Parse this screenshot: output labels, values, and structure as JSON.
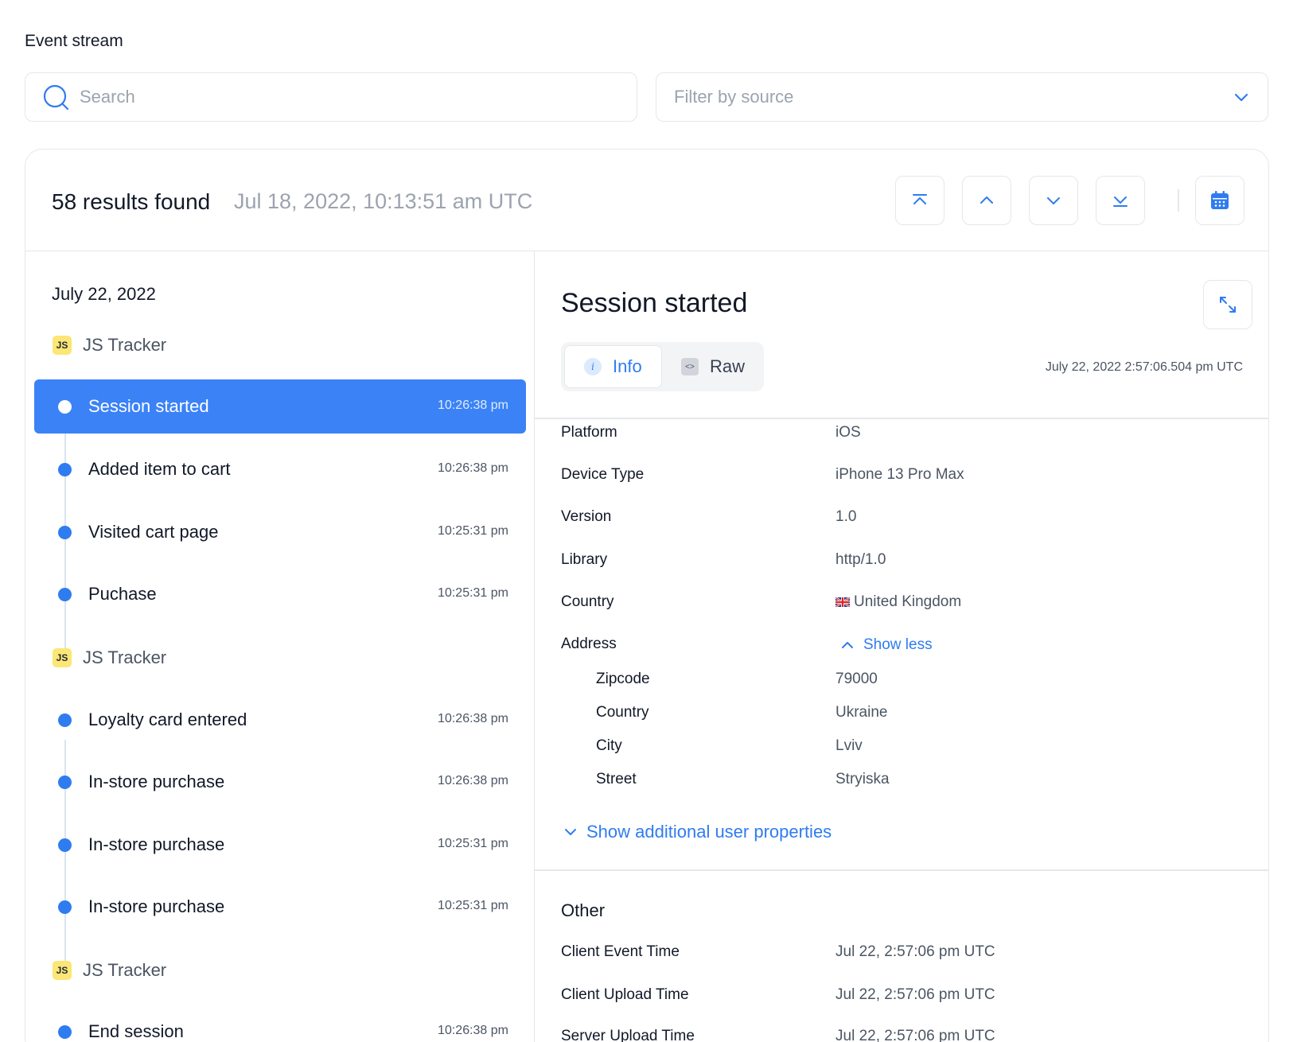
{
  "page": {
    "title": "Event stream"
  },
  "search": {
    "placeholder": "Search"
  },
  "filter": {
    "placeholder": "Filter by source"
  },
  "results": {
    "count_text": "58 results found",
    "date": "Jul 18, 2022, 10:13:51 am UTC"
  },
  "colors": {
    "accent": "#3b82f6",
    "link": "#2f7cf0",
    "badge": "#fce675",
    "border": "#e5e7eb"
  },
  "icons": [
    "search-icon",
    "chevron-down-icon",
    "jump-to-first-icon",
    "chevron-up-icon",
    "jump-to-last-icon",
    "calendar-icon",
    "expand-icon",
    "info-icon",
    "code-file-icon",
    "uk-flag-icon"
  ],
  "stream": {
    "date": "July 22, 2022",
    "groups": [
      {
        "source": "JS Tracker",
        "badge": "JS",
        "events": [
          {
            "name": "Session started",
            "time": "10:26:38 pm",
            "active": true
          },
          {
            "name": "Added item to cart",
            "time": "10:26:38 pm"
          },
          {
            "name": "Visited cart page",
            "time": "10:25:31 pm"
          },
          {
            "name": "Puchase",
            "time": "10:25:31 pm"
          }
        ]
      },
      {
        "source": "JS Tracker",
        "badge": "JS",
        "events": [
          {
            "name": "Loyalty card entered",
            "time": "10:26:38 pm"
          },
          {
            "name": "In-store purchase",
            "time": "10:26:38 pm"
          },
          {
            "name": "In-store purchase",
            "time": "10:25:31 pm"
          },
          {
            "name": "In-store purchase",
            "time": "10:25:31 pm"
          }
        ]
      },
      {
        "source": "JS Tracker",
        "badge": "JS",
        "events": [
          {
            "name": "End session",
            "time": "10:26:38 pm"
          }
        ]
      }
    ]
  },
  "detail": {
    "title": "Session started",
    "tabs": {
      "info": "Info",
      "raw": "Raw"
    },
    "timestamp": "July 22, 2022 2:57:06.504 pm UTC",
    "props": {
      "platform": {
        "label": "Platform",
        "value": "iOS"
      },
      "device": {
        "label": "Device Type",
        "value": "iPhone 13 Pro Max"
      },
      "version": {
        "label": "Version",
        "value": "1.0"
      },
      "library": {
        "label": "Library",
        "value": "http/1.0"
      },
      "country": {
        "label": "Country",
        "value": "United Kingdom"
      },
      "address": {
        "label": "Address",
        "toggle": "Show less"
      },
      "zipcode": {
        "label": "Zipcode",
        "value": "79000"
      },
      "addr_country": {
        "label": "Country",
        "value": "Ukraine"
      },
      "city": {
        "label": "City",
        "value": "Lviv"
      },
      "street": {
        "label": "Street",
        "value": "Stryiska"
      }
    },
    "show_more": "Show additional user properties",
    "other": {
      "title": "Other",
      "client_event": {
        "label": "Client Event Time",
        "value": "Jul 22, 2:57:06 pm UTC"
      },
      "client_upload": {
        "label": "Client Upload Time",
        "value": "Jul 22, 2:57:06 pm UTC"
      },
      "server_upload": {
        "label": "Server Upload Time",
        "value": "Jul 22, 2:57:06 pm UTC"
      }
    }
  }
}
